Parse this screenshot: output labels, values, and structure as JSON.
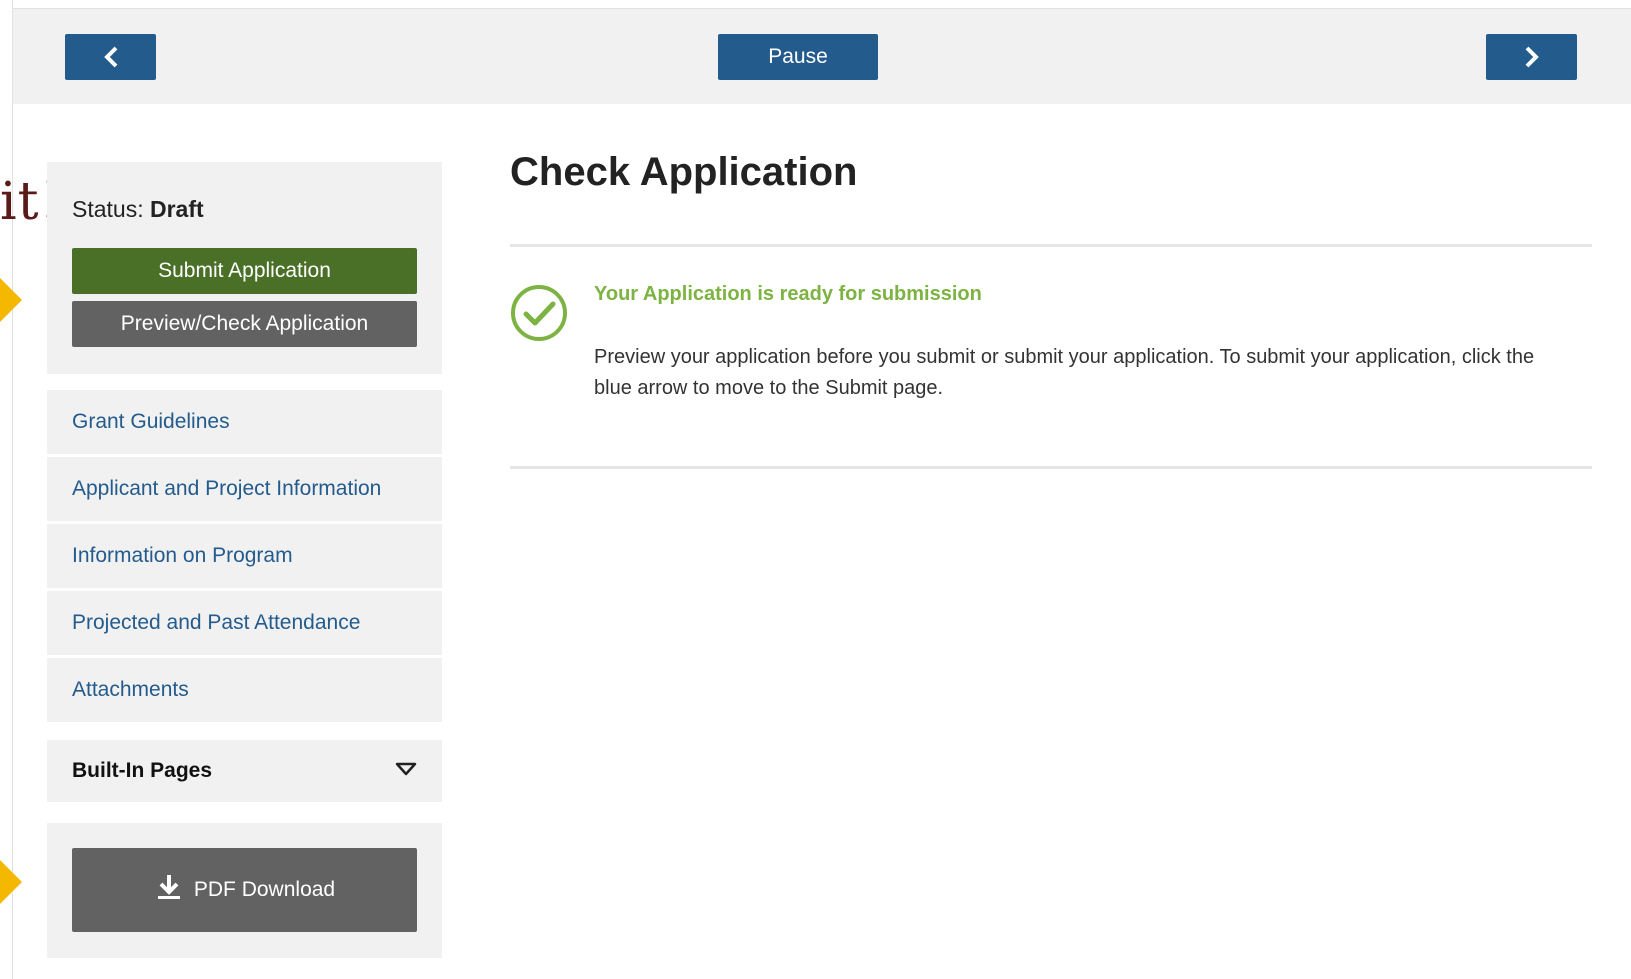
{
  "annotation": {
    "text": "it!"
  },
  "topbar": {
    "pause_label": "Pause"
  },
  "status": {
    "label": "Status:",
    "value": "Draft"
  },
  "actions": {
    "submit_label": "Submit Application",
    "preview_label": "Preview/Check Application"
  },
  "sidebar": {
    "items": [
      {
        "label": "Grant Guidelines"
      },
      {
        "label": "Applicant and Project Information"
      },
      {
        "label": "Information on Program"
      },
      {
        "label": "Projected and Past Attendance"
      },
      {
        "label": "Attachments"
      }
    ],
    "builtin_label": "Built-In Pages"
  },
  "pdf": {
    "label": "PDF Download"
  },
  "main": {
    "title": "Check Application",
    "ready_message": "Your Application is ready for submission",
    "ready_description": "Preview your application before you submit or submit your application. To submit your application, click the blue arrow to move to the Submit page."
  },
  "colors": {
    "primary": "#245b8d",
    "submit": "#4a7028",
    "secondary": "#626262",
    "success": "#7cb342",
    "annotation_arrow": "#f5b800",
    "annotation_text": "#5a1a1a"
  },
  "icons": {
    "prev": "chevron-left-icon",
    "next": "chevron-right-icon",
    "check": "check-circle-icon",
    "dropdown": "triangle-down-icon",
    "download": "download-icon"
  }
}
